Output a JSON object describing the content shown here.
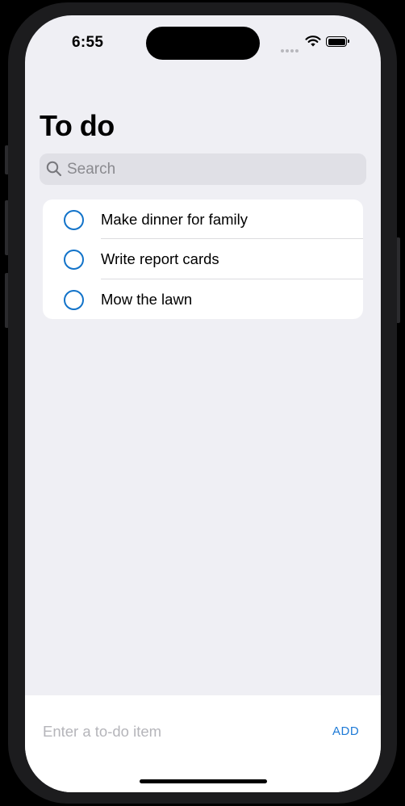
{
  "status_bar": {
    "time": "6:55"
  },
  "header": {
    "title": "To do"
  },
  "search": {
    "placeholder": "Search",
    "value": ""
  },
  "todos": [
    {
      "label": "Make dinner for family",
      "done": false
    },
    {
      "label": "Write report cards",
      "done": false
    },
    {
      "label": "Mow the lawn",
      "done": false
    }
  ],
  "composer": {
    "placeholder": "Enter a to-do item",
    "add_label": "ADD"
  },
  "colors": {
    "accent": "#1273c9",
    "background": "#efeff4",
    "card": "#ffffff"
  }
}
